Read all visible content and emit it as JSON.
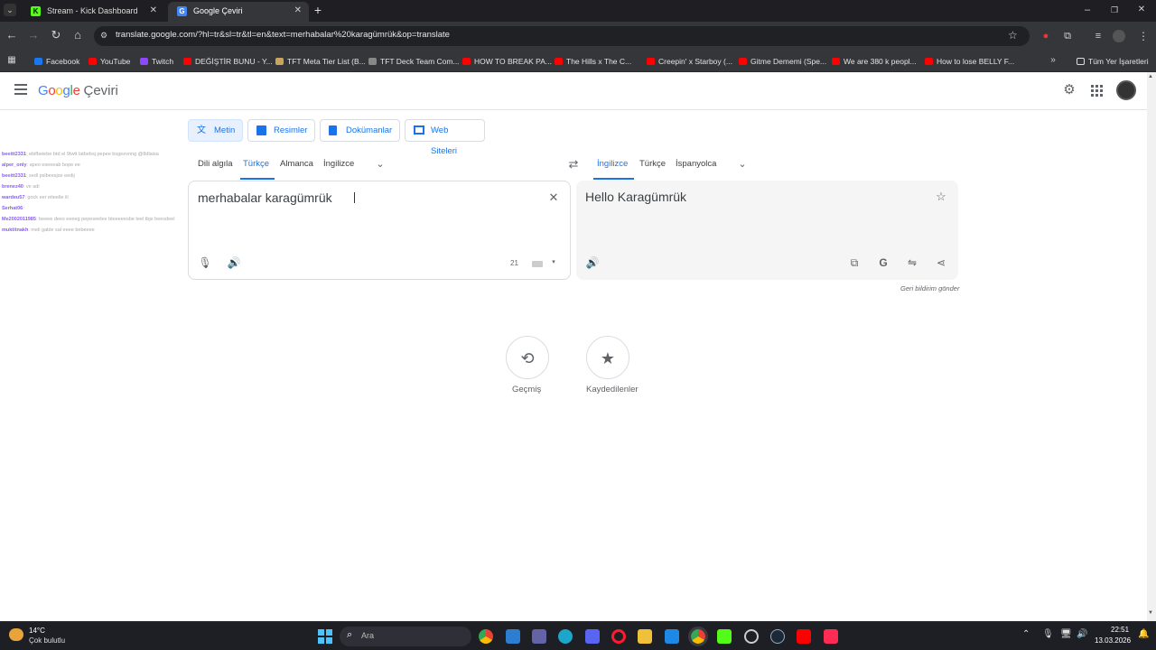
{
  "tabs": [
    {
      "title": "Stream - Kick Dashboard",
      "favicon": "kick-icon",
      "active": false
    },
    {
      "title": "Google Çeviri",
      "favicon": "google-translate-icon",
      "active": true
    }
  ],
  "address_bar": {
    "url": "translate.google.com/?hl=tr&sl=tr&tl=en&text=merhabalar%20karagümrük&op=translate"
  },
  "bookmarks": [
    {
      "label": "Facebook",
      "color": "#1877f2"
    },
    {
      "label": "YouTube",
      "color": "#ff0000"
    },
    {
      "label": "Twitch",
      "color": "#9146ff"
    },
    {
      "label": "DEĞİŞTİR BUNU - Y...",
      "color": "#ff0000"
    },
    {
      "label": "TFT Meta Tier List (B...",
      "color": "#c9a45c"
    },
    {
      "label": "TFT Deck Team Com...",
      "color": "#888888"
    },
    {
      "label": "HOW TO BREAK PA...",
      "color": "#ff0000"
    },
    {
      "label": "The Hills x The C...",
      "color": "#ff0000"
    },
    {
      "label": "Creepin' x Starboy (...",
      "color": "#ff0000"
    },
    {
      "label": "Gitme Dememi (Spe...",
      "color": "#ff0000"
    },
    {
      "label": "We are 380 k peopl...",
      "color": "#ff0000"
    },
    {
      "label": "How to lose BELLY F...",
      "color": "#ff0000"
    }
  ],
  "all_bookmarks_label": "Tüm Yer İşaretleri",
  "app": {
    "logo_google": "Google",
    "logo_product": "Çeviri"
  },
  "modes": [
    {
      "label": "Metin",
      "active": true
    },
    {
      "label": "Resimler",
      "active": false
    },
    {
      "label": "Dokümanlar",
      "active": false
    },
    {
      "label": "Web Siteleri",
      "active": false
    }
  ],
  "source_langs": [
    {
      "label": "Dili algıla",
      "active": false
    },
    {
      "label": "Türkçe",
      "active": true
    },
    {
      "label": "Almanca",
      "active": false
    },
    {
      "label": "İngilizce",
      "active": false
    }
  ],
  "target_langs": [
    {
      "label": "İngilizce",
      "active": true
    },
    {
      "label": "Türkçe",
      "active": false
    },
    {
      "label": "İspanyolca",
      "active": false
    }
  ],
  "source": {
    "text": "merhabalar karagümrük",
    "char_count": "21"
  },
  "target": {
    "text": "Hello Karagümrük"
  },
  "feedback_label": "Geri bildirim gönder",
  "shortcuts": [
    {
      "label": "Geçmiş",
      "icon": "history-icon"
    },
    {
      "label": "Kaydedilenler",
      "icon": "star-icon"
    }
  ],
  "chat_overlay": [
    {
      "user": "beeitt2331",
      "msg": ": ebifbeiebe btd el 9twtt latbebsj pepee bsgeevnng @8dlaisa"
    },
    {
      "user": "alper_only",
      "msg": ": apeo eseeeab bope ee"
    },
    {
      "user": "beeitt2331",
      "msg": ": sedl pslbeesjse eedij"
    },
    {
      "user": "brenez40",
      "msg": ": ve adi"
    },
    {
      "user": "wardeu57",
      "msg": ": gock eer eiteelle ili"
    },
    {
      "user": "Serhat06",
      "msg": ":"
    },
    {
      "user": "Me2002011985",
      "msg": ": beeee dees eeeeg pepeseelee bteeeeesbe teel tbje beesdeel"
    },
    {
      "user": "muktitnakh",
      "msg": ": meli gable sal eeee bebeeee"
    }
  ],
  "weather": {
    "temp": "14°C",
    "desc": "Çok bulutlu"
  },
  "taskbar_search_placeholder": "Ara",
  "clock": {
    "time": "22:51",
    "date": "13.03.2026"
  }
}
